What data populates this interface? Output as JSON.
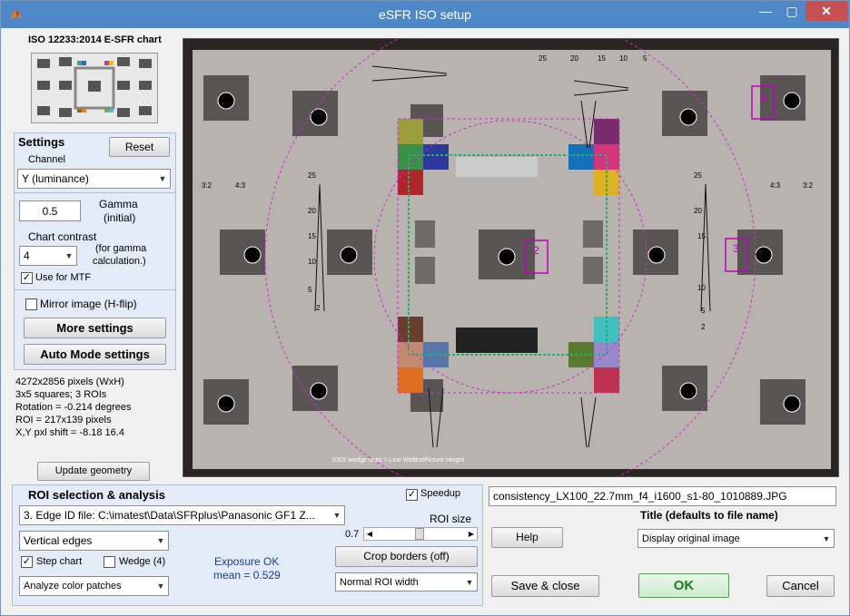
{
  "window": {
    "title": "eSFR ISO setup"
  },
  "chart_panel": {
    "title": "ISO 12233:2014 E-SFR chart"
  },
  "settings": {
    "title": "Settings",
    "reset_label": "Reset",
    "channel_label": "Channel",
    "channel_value": "Y (luminance)",
    "gamma_value": "0.5",
    "gamma_label_1": "Gamma",
    "gamma_label_2": "(initial)",
    "contrast_label": "Chart contrast",
    "contrast_value": "4",
    "contrast_note_1": "(for gamma",
    "contrast_note_2": "calculation.)",
    "use_mtf_label": "Use for MTF",
    "use_mtf_checked": "✓",
    "mirror_label": "Mirror image (H-flip)",
    "more_settings_label": "More settings",
    "auto_mode_label": "Auto Mode settings"
  },
  "info": {
    "line1": "4272x2856 pixels (WxH)",
    "line2": "3x5 squares;   3 ROIs",
    "line3": "Rotation = -0.214 degrees",
    "line4": "ROI = 217x139 pixels",
    "line5": "X,Y pxl shift = -8.18  16.4"
  },
  "update_geometry_label": "Update geometry",
  "image_overlay": {
    "bottom_caption": "100X wedge units = Line Widths/Picture Height",
    "top_scale": [
      "25",
      "20",
      "15",
      "10",
      "5"
    ],
    "left_scale": [
      "25",
      "20",
      "15",
      "10",
      "5",
      "2"
    ],
    "right_scale": [
      "25",
      "20",
      "15",
      "10",
      "5",
      "2"
    ],
    "side_marks": [
      "3:2",
      "4:3"
    ],
    "roi_numbers": [
      "1",
      "2",
      "3"
    ]
  },
  "roi": {
    "title": "ROI selection & analysis",
    "speedup_label": "Speedup",
    "speedup_checked": "✓",
    "edge_id_value": "3.   Edge ID file: C:\\imatest\\Data\\SFRplus\\Panasonic GF1 Z...",
    "edges_value": "Vertical edges",
    "step_chart_label": "Step chart",
    "step_chart_checked": "✓",
    "wedge_label": "Wedge (4)",
    "exposure_line1": "Exposure OK",
    "exposure_line2": "mean = 0.529",
    "analyze_value": "Analyze color patches",
    "roi_size_label": "ROI size",
    "roi_size_value": "0.7",
    "crop_label": "Crop borders  (off)",
    "roi_width_value": "Normal ROI width"
  },
  "right": {
    "filename": "consistency_LX100_22.7mm_f4_i1600_s1-80_1010889.JPG",
    "title_label": "Title (defaults to file name)",
    "help_label": "Help",
    "display_value": "Display original image",
    "save_close_label": "Save & close",
    "ok_label": "OK",
    "cancel_label": "Cancel"
  },
  "colors": {
    "titlebar": "#4f88c8",
    "panel": "#e2ebf6",
    "ok_text": "#1f7a1f",
    "roi_box": "#c000c0"
  }
}
